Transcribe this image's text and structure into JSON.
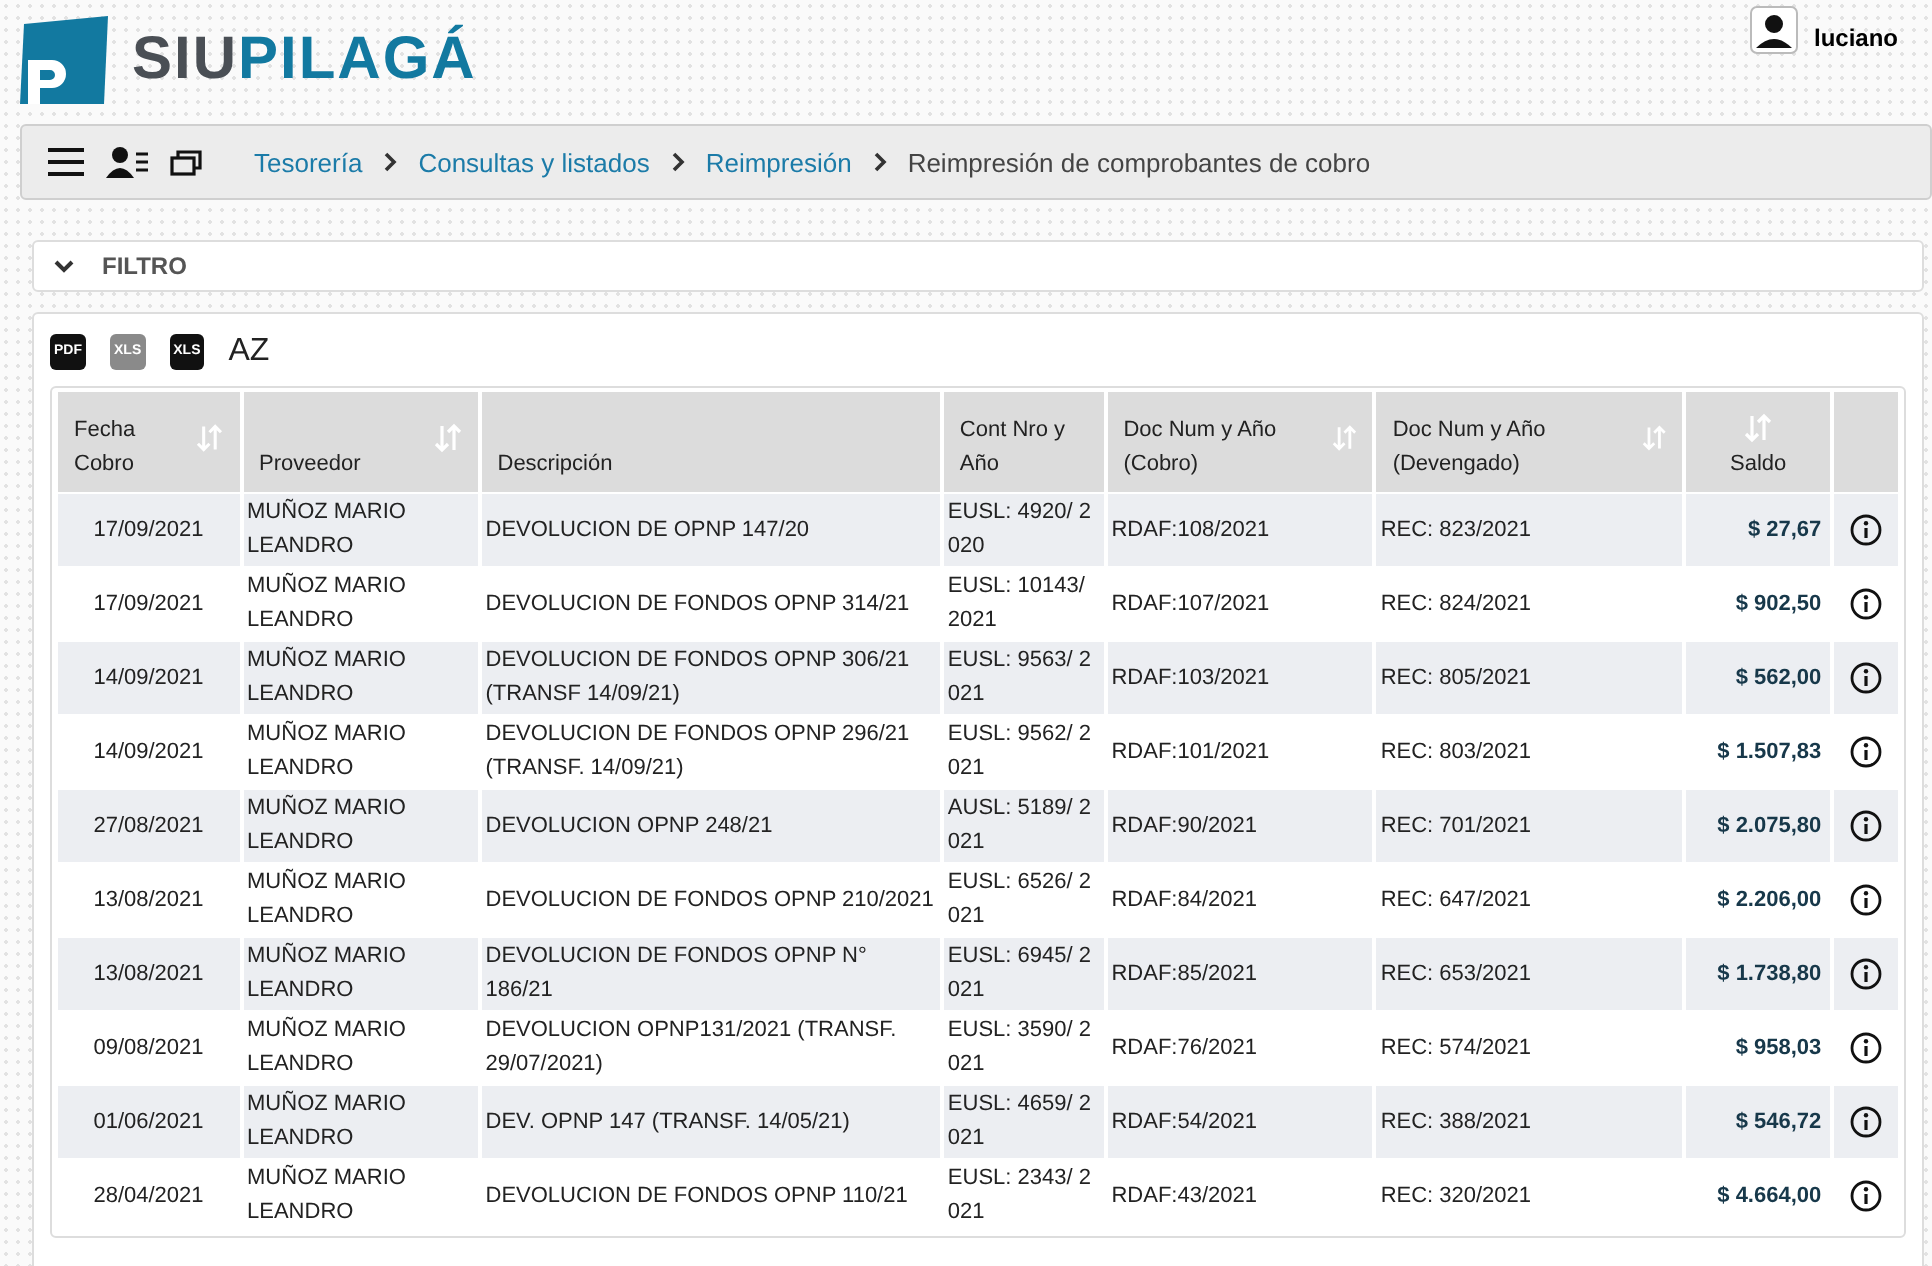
{
  "header": {
    "logo_text_1": "SIU",
    "logo_text_2": "PILAGÁ",
    "user": "luciano"
  },
  "breadcrumb": [
    {
      "label": "Tesorería",
      "link": true
    },
    {
      "label": "Consultas y listados",
      "link": true
    },
    {
      "label": "Reimpresión",
      "link": true
    },
    {
      "label": "Reimpresión de comprobantes de cobro",
      "link": false
    }
  ],
  "filter": {
    "title": "FILTRO"
  },
  "toolbar": [
    {
      "label": "PDF",
      "disabled": false
    },
    {
      "label": "XLS",
      "disabled": true
    },
    {
      "label": "XLS",
      "disabled": false
    }
  ],
  "sort_button": {
    "label": "AZ"
  },
  "table": {
    "columns": [
      {
        "label": "Fecha Cobro",
        "sortable": true
      },
      {
        "label": "Proveedor",
        "sortable": true
      },
      {
        "label": "Descripción",
        "sortable": false
      },
      {
        "label": "Cont Nro y Año",
        "sortable": false
      },
      {
        "label": "Doc Num y Año (Cobro)",
        "sortable": true
      },
      {
        "label": "Doc Num y Año (Devengado)",
        "sortable": true
      },
      {
        "label": "Saldo",
        "sortable": true
      }
    ],
    "rows": [
      {
        "cells": [
          "17/09/2021",
          "MUÑOZ MARIO LEANDRO",
          "DEVOLUCION DE OPNP 147/20",
          "EUSL: 4920/ 2020",
          "RDAF:108/2021",
          "REC: 823/2021",
          "$ 27,67"
        ]
      },
      {
        "cells": [
          "17/09/2021",
          "MUÑOZ MARIO LEANDRO",
          "DEVOLUCION DE FONDOS OPNP 314/21",
          "EUSL: 10143/ 2021",
          "RDAF:107/2021",
          "REC: 824/2021",
          "$ 902,50"
        ]
      },
      {
        "cells": [
          "14/09/2021",
          "MUÑOZ MARIO LEANDRO",
          "DEVOLUCION DE FONDOS OPNP 306/21 (TRANSF 14/09/21)",
          "EUSL: 9563/ 2021",
          "RDAF:103/2021",
          "REC: 805/2021",
          "$ 562,00"
        ]
      },
      {
        "cells": [
          "14/09/2021",
          "MUÑOZ MARIO LEANDRO",
          "DEVOLUCION DE FONDOS OPNP 296/21 (TRANSF. 14/09/21)",
          "EUSL: 9562/ 2021",
          "RDAF:101/2021",
          "REC: 803/2021",
          "$ 1.507,83"
        ]
      },
      {
        "cells": [
          "27/08/2021",
          "MUÑOZ MARIO LEANDRO",
          "DEVOLUCION OPNP 248/21",
          "AUSL: 5189/ 2021",
          "RDAF:90/2021",
          "REC: 701/2021",
          "$ 2.075,80"
        ]
      },
      {
        "cells": [
          "13/08/2021",
          "MUÑOZ MARIO LEANDRO",
          "DEVOLUCION DE FONDOS OPNP 210/2021",
          "EUSL: 6526/ 2021",
          "RDAF:84/2021",
          "REC: 647/2021",
          "$ 2.206,00"
        ]
      },
      {
        "cells": [
          "13/08/2021",
          "MUÑOZ MARIO LEANDRO",
          "DEVOLUCION DE FONDOS OPNP N° 186/21",
          "EUSL: 6945/ 2021",
          "RDAF:85/2021",
          "REC: 653/2021",
          "$ 1.738,80"
        ]
      },
      {
        "cells": [
          "09/08/2021",
          "MUÑOZ MARIO LEANDRO",
          "DEVOLUCION OPNP131/2021 (TRANSF. 29/07/2021)",
          "EUSL: 3590/ 2021",
          "RDAF:76/2021",
          "REC: 574/2021",
          "$ 958,03"
        ]
      },
      {
        "cells": [
          "01/06/2021",
          "MUÑOZ MARIO LEANDRO",
          "DEV. OPNP 147 (TRANSF. 14/05/21)",
          "EUSL: 4659/ 2021",
          "RDAF:54/2021",
          "REC: 388/2021",
          "$ 546,72"
        ]
      },
      {
        "cells": [
          "28/04/2021",
          "MUÑOZ MARIO LEANDRO",
          "DEVOLUCION DE FONDOS OPNP 110/21",
          "EUSL: 2343/ 2021",
          "RDAF:43/2021",
          "REC: 320/2021",
          "$ 4.664,00"
        ]
      }
    ]
  }
}
